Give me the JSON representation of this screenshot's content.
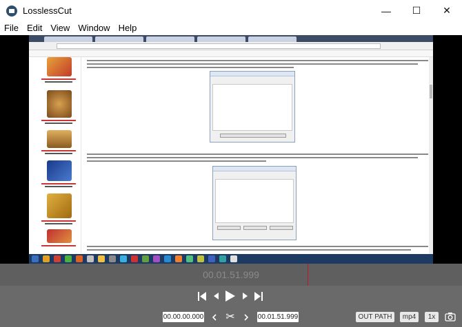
{
  "window": {
    "title": "LosslessCut",
    "minimize": "—",
    "maximize": "☐",
    "close": "✕"
  },
  "menu": [
    "File",
    "Edit",
    "View",
    "Window",
    "Help"
  ],
  "player": {
    "current_time": "00.01.51.999",
    "cut_start": "00.00.00.000",
    "cut_end": "00.01.51.999",
    "out_path_label": "OUT PATH",
    "format_label": "mp4",
    "speed_label": "1x"
  },
  "icons": {
    "jump_start": "⏮",
    "prev_frame": "◀",
    "play": "▶",
    "next_frame": "▶",
    "jump_end": "⏭",
    "set_cut_start": "‹",
    "cut": "✂",
    "set_cut_end": "›"
  },
  "colors": {
    "timeline_bg": "#5f5f5f",
    "controls_bg": "#6a6a6a",
    "cursor": "#c0152f"
  }
}
